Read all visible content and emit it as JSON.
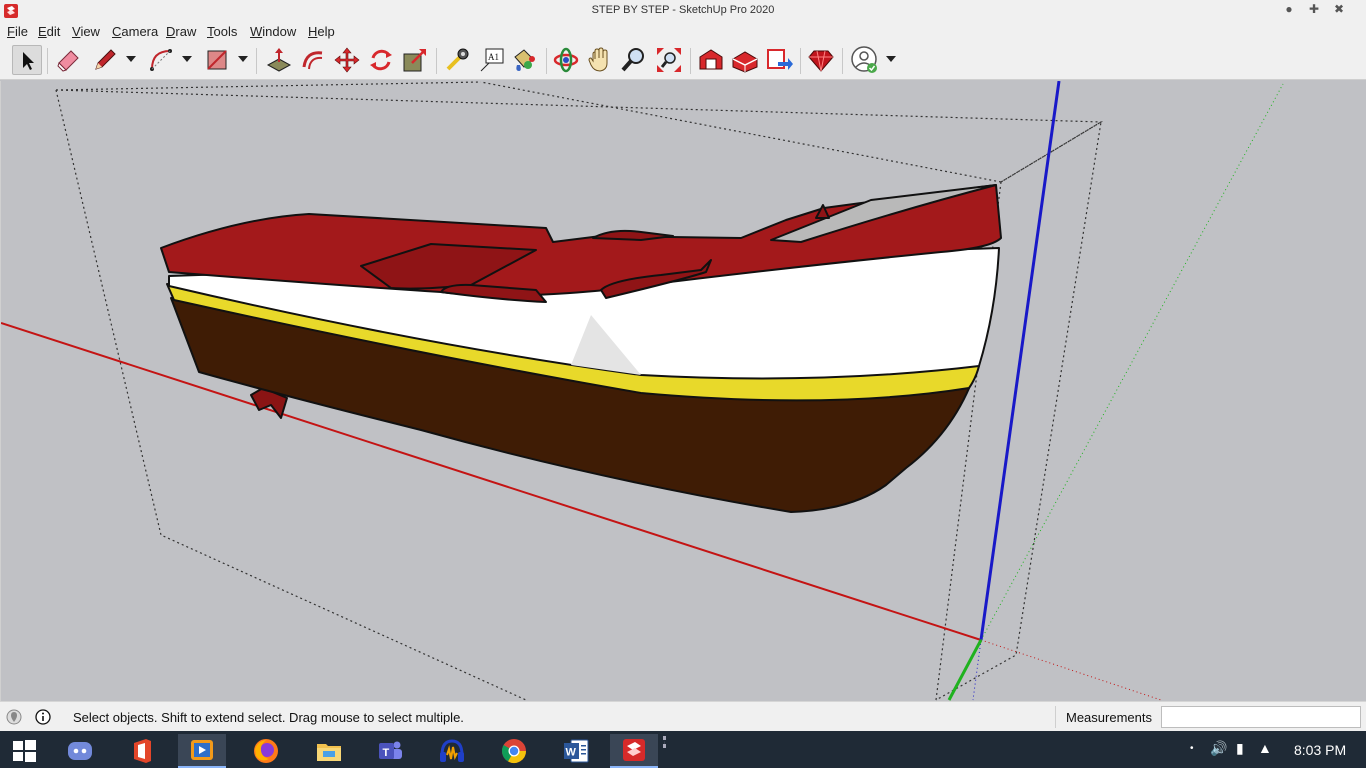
{
  "window": {
    "title": "STEP BY STEP - SketchUp Pro 2020"
  },
  "menu": {
    "items": [
      {
        "label": "File",
        "mnemonic": "F"
      },
      {
        "label": "Edit",
        "mnemonic": "E"
      },
      {
        "label": "View",
        "mnemonic": "V"
      },
      {
        "label": "Camera",
        "mnemonic": "C"
      },
      {
        "label": "Draw",
        "mnemonic": "D"
      },
      {
        "label": "Tools",
        "mnemonic": "T"
      },
      {
        "label": "Window",
        "mnemonic": "W"
      },
      {
        "label": "Help",
        "mnemonic": "H"
      }
    ]
  },
  "toolbar": {
    "tools": [
      "select-tool",
      "eraser-tool",
      "line-tool",
      "arc-tool",
      "shape-tool",
      "push-pull-tool",
      "offset-tool",
      "move-tool",
      "rotate-tool",
      "scale-tool",
      "tape-measure-tool",
      "text-tool",
      "paint-bucket-tool",
      "orbit-tool",
      "pan-tool",
      "zoom-tool",
      "zoom-extents-tool",
      "warehouse-tool",
      "extension-warehouse-tool",
      "send-to-layout-tool",
      "ruby-tool",
      "account-tool"
    ],
    "text_tool_label": "A1"
  },
  "colors": {
    "hull_red": "#a3191b",
    "hull_white": "#ffffff",
    "stripe_yellow": "#e8d92a",
    "hull_brown": "#3f1c05",
    "axis_red": "#c41414",
    "axis_green": "#1fb21f",
    "axis_blue": "#1919c8"
  },
  "status": {
    "hint": "Select objects. Shift to extend select. Drag mouse to select multiple.",
    "measurements_label": "Measurements",
    "measurements_value": ""
  },
  "taskbar": {
    "apps": [
      "windows-start",
      "discord",
      "office",
      "media-player",
      "firefox",
      "file-explorer",
      "teams",
      "audacity",
      "chrome",
      "word",
      "sketchup"
    ],
    "clock": "8:03 PM"
  }
}
